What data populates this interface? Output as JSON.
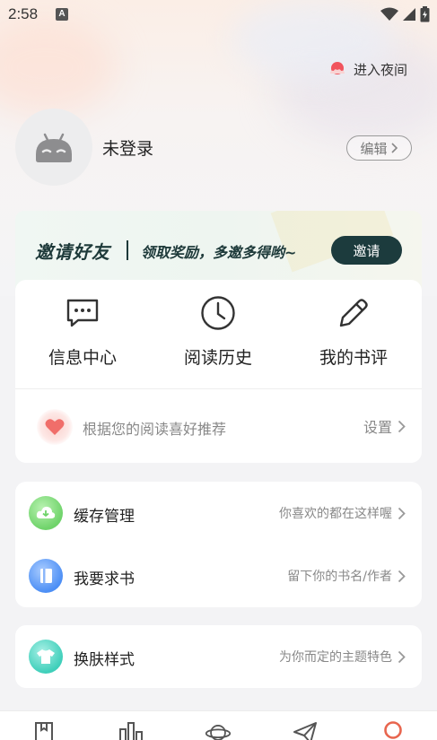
{
  "status_bar": {
    "time": "2:58",
    "notification_letter": "A"
  },
  "header": {
    "night_mode_label": "进入夜间"
  },
  "profile": {
    "username": "未登录",
    "edit_label": "编辑"
  },
  "invite": {
    "title": "邀请好友",
    "subtitle": "领取奖励，多邀多得哟~",
    "button_label": "邀请"
  },
  "quick_actions": [
    {
      "label": "信息中心",
      "icon": "message-icon"
    },
    {
      "label": "阅读历史",
      "icon": "clock-icon"
    },
    {
      "label": "我的书评",
      "icon": "pen-icon"
    }
  ],
  "recommend": {
    "label": "根据您的阅读喜好推荐",
    "settings_label": "设置"
  },
  "menu": {
    "cache": {
      "label": "缓存管理",
      "hint": "你喜欢的都在这样喔"
    },
    "request_book": {
      "label": "我要求书",
      "hint": "留下你的书名/作者"
    },
    "skin": {
      "label": "换肤样式",
      "hint": "为你而定的主题特色"
    }
  },
  "bottom_nav": [
    {
      "icon": "bookshelf-icon"
    },
    {
      "icon": "ranking-icon"
    },
    {
      "icon": "discover-planet-icon"
    },
    {
      "icon": "paper-plane-icon"
    },
    {
      "icon": "profile-ring-icon",
      "active": true
    }
  ],
  "colors": {
    "accent": "#e8664f",
    "invite_dark": "#1c3b3d",
    "text_secondary": "#888888"
  }
}
